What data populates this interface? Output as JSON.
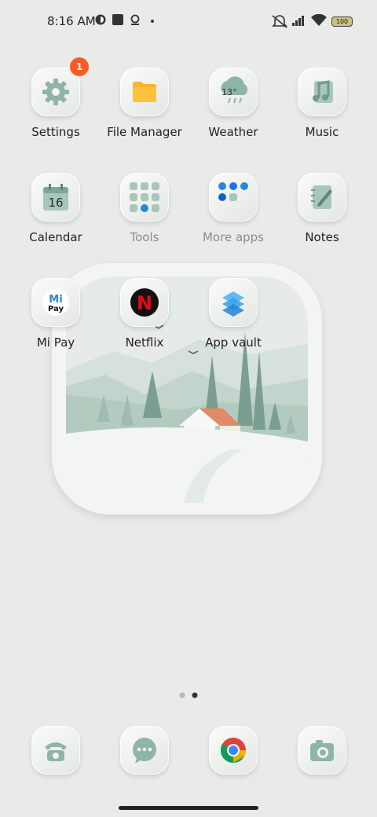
{
  "status_bar": {
    "time": "8:16 AM",
    "battery": "100",
    "icons": [
      "dnd-mute-icon",
      "signal-icon",
      "wifi-icon",
      "battery-icon"
    ]
  },
  "apps": [
    {
      "label": "Settings",
      "badge": "1",
      "icon": "gear-icon"
    },
    {
      "label": "File Manager",
      "icon": "folder-icon"
    },
    {
      "label": "Weather",
      "icon": "weather-cloud-icon",
      "temp": "13°"
    },
    {
      "label": "Music",
      "icon": "music-note-icon"
    },
    {
      "label": "Calendar",
      "icon": "calendar-icon",
      "day": "16"
    },
    {
      "label": "Tools",
      "icon": "folder-grid-icon"
    },
    {
      "label": "More apps",
      "icon": "folder-grid-icon"
    },
    {
      "label": "Notes",
      "icon": "notes-pen-icon"
    },
    {
      "label": "Mi Pay",
      "icon": "mi-pay-icon",
      "logo_top": "Mi",
      "logo_bottom": "Pay"
    },
    {
      "label": "Netflix",
      "icon": "netflix-icon",
      "logo": "N"
    },
    {
      "label": "App vault",
      "icon": "app-vault-icon"
    }
  ],
  "dock": [
    {
      "icon": "phone-icon"
    },
    {
      "icon": "messages-icon"
    },
    {
      "icon": "chrome-icon"
    },
    {
      "icon": "camera-icon"
    }
  ],
  "page_indicator": {
    "count": 2,
    "active": 2
  },
  "colors": {
    "background": "#e9ebe8",
    "accent_green": "#8fb5a6",
    "badge": "#ff5a1f",
    "netflix_red": "#e50914"
  }
}
